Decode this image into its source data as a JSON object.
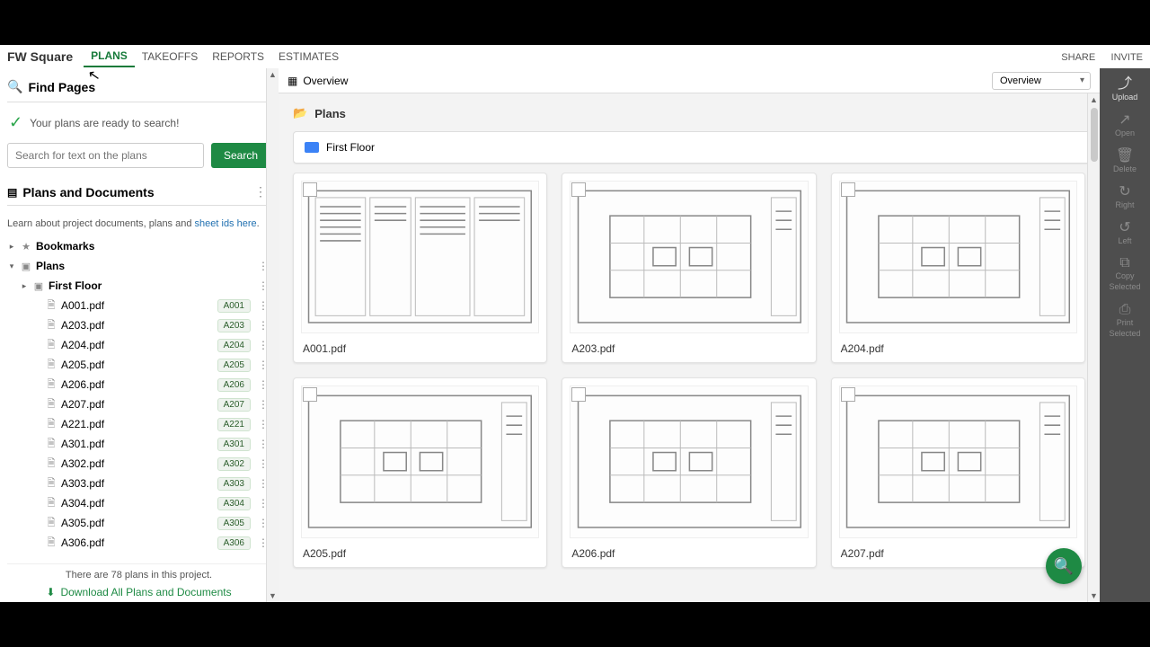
{
  "brand": "FW Square",
  "nav": {
    "plans": "PLANS",
    "takeoffs": "TAKEOFFS",
    "reports": "REPORTS",
    "estimates": "ESTIMATES",
    "share": "SHARE",
    "invite": "INVITE"
  },
  "find": {
    "title": "Find Pages",
    "ready": "Your plans are ready to search!",
    "placeholder": "Search for text on the plans",
    "button": "Search"
  },
  "docs": {
    "title": "Plans and Documents",
    "help_prefix": "Learn about project documents, plans and ",
    "help_link1": "sheet ids",
    "help_link2": "here",
    "bookmarks": "Bookmarks",
    "plans": "Plans",
    "first_floor": "First Floor",
    "files": [
      {
        "name": "A001.pdf",
        "badge": "A001"
      },
      {
        "name": "A203.pdf",
        "badge": "A203"
      },
      {
        "name": "A204.pdf",
        "badge": "A204"
      },
      {
        "name": "A205.pdf",
        "badge": "A205"
      },
      {
        "name": "A206.pdf",
        "badge": "A206"
      },
      {
        "name": "A207.pdf",
        "badge": "A207"
      },
      {
        "name": "A221.pdf",
        "badge": "A221"
      },
      {
        "name": "A301.pdf",
        "badge": "A301"
      },
      {
        "name": "A302.pdf",
        "badge": "A302"
      },
      {
        "name": "A303.pdf",
        "badge": "A303"
      },
      {
        "name": "A304.pdf",
        "badge": "A304"
      },
      {
        "name": "A305.pdf",
        "badge": "A305"
      },
      {
        "name": "A306.pdf",
        "badge": "A306"
      }
    ],
    "count_text": "There are 78 plans in this project.",
    "download": "Download All Plans and Documents"
  },
  "main": {
    "overview": "Overview",
    "dropdown": "Overview",
    "crumb": "Plans",
    "folder": "First Floor",
    "cards": [
      {
        "name": "A001.pdf"
      },
      {
        "name": "A203.pdf"
      },
      {
        "name": "A204.pdf"
      },
      {
        "name": "A205.pdf"
      },
      {
        "name": "A206.pdf"
      },
      {
        "name": "A207.pdf"
      }
    ]
  },
  "rail": {
    "upload": "Upload",
    "open": "Open",
    "delete": "Delete",
    "right": "Right",
    "left": "Left",
    "copy1": "Copy",
    "copy2": "Selected",
    "print1": "Print",
    "print2": "Selected"
  }
}
